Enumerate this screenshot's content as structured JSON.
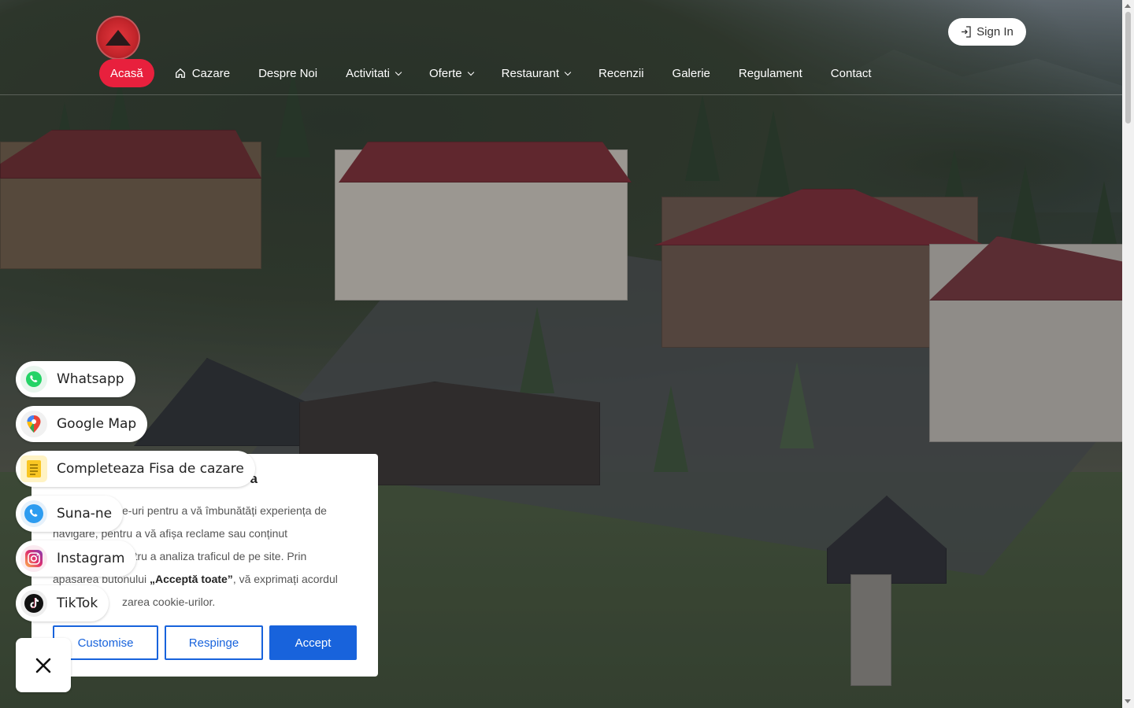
{
  "header": {
    "signin_label": "Sign In",
    "nav": [
      {
        "label": "Acasă",
        "active": true
      },
      {
        "label": "Cazare"
      },
      {
        "label": "Despre Noi"
      },
      {
        "label": "Activitati",
        "dropdown": true
      },
      {
        "label": "Oferte",
        "dropdown": true
      },
      {
        "label": "Restaurant",
        "dropdown": true
      },
      {
        "label": "Recenzii"
      },
      {
        "label": "Galerie"
      },
      {
        "label": "Regulament"
      },
      {
        "label": "Contact"
      }
    ]
  },
  "colors": {
    "accent": "#e8203d",
    "cookie_blue": "#1863dc"
  },
  "cookie": {
    "title": "ea",
    "text_1": "e-uri pentru a vă îmbunătăți experiența de",
    "text_2": "navigare, pentru a vă afișa reclame sau conținut",
    "text_3": "entru a analiza traficul de pe site. Prin",
    "text_4a": "apăsarea butonului ",
    "text_4b": "„Acceptă toate”",
    "text_4c": ", vă exprimați acordul",
    "text_5": "zarea cookie-urilor.",
    "customise_label": "Customise",
    "reject_label": "Respinge",
    "accept_label": "Accept"
  },
  "contacts": [
    {
      "label": "Whatsapp",
      "icon": "whatsapp-icon"
    },
    {
      "label": "Google Map",
      "icon": "map-pin-icon"
    },
    {
      "label": "Completeaza Fisa de cazare",
      "icon": "notes-icon"
    },
    {
      "label": "Suna-ne",
      "icon": "phone-icon"
    },
    {
      "label": "Instagram",
      "icon": "instagram-icon"
    },
    {
      "label": "TikTok",
      "icon": "tiktok-icon"
    }
  ]
}
